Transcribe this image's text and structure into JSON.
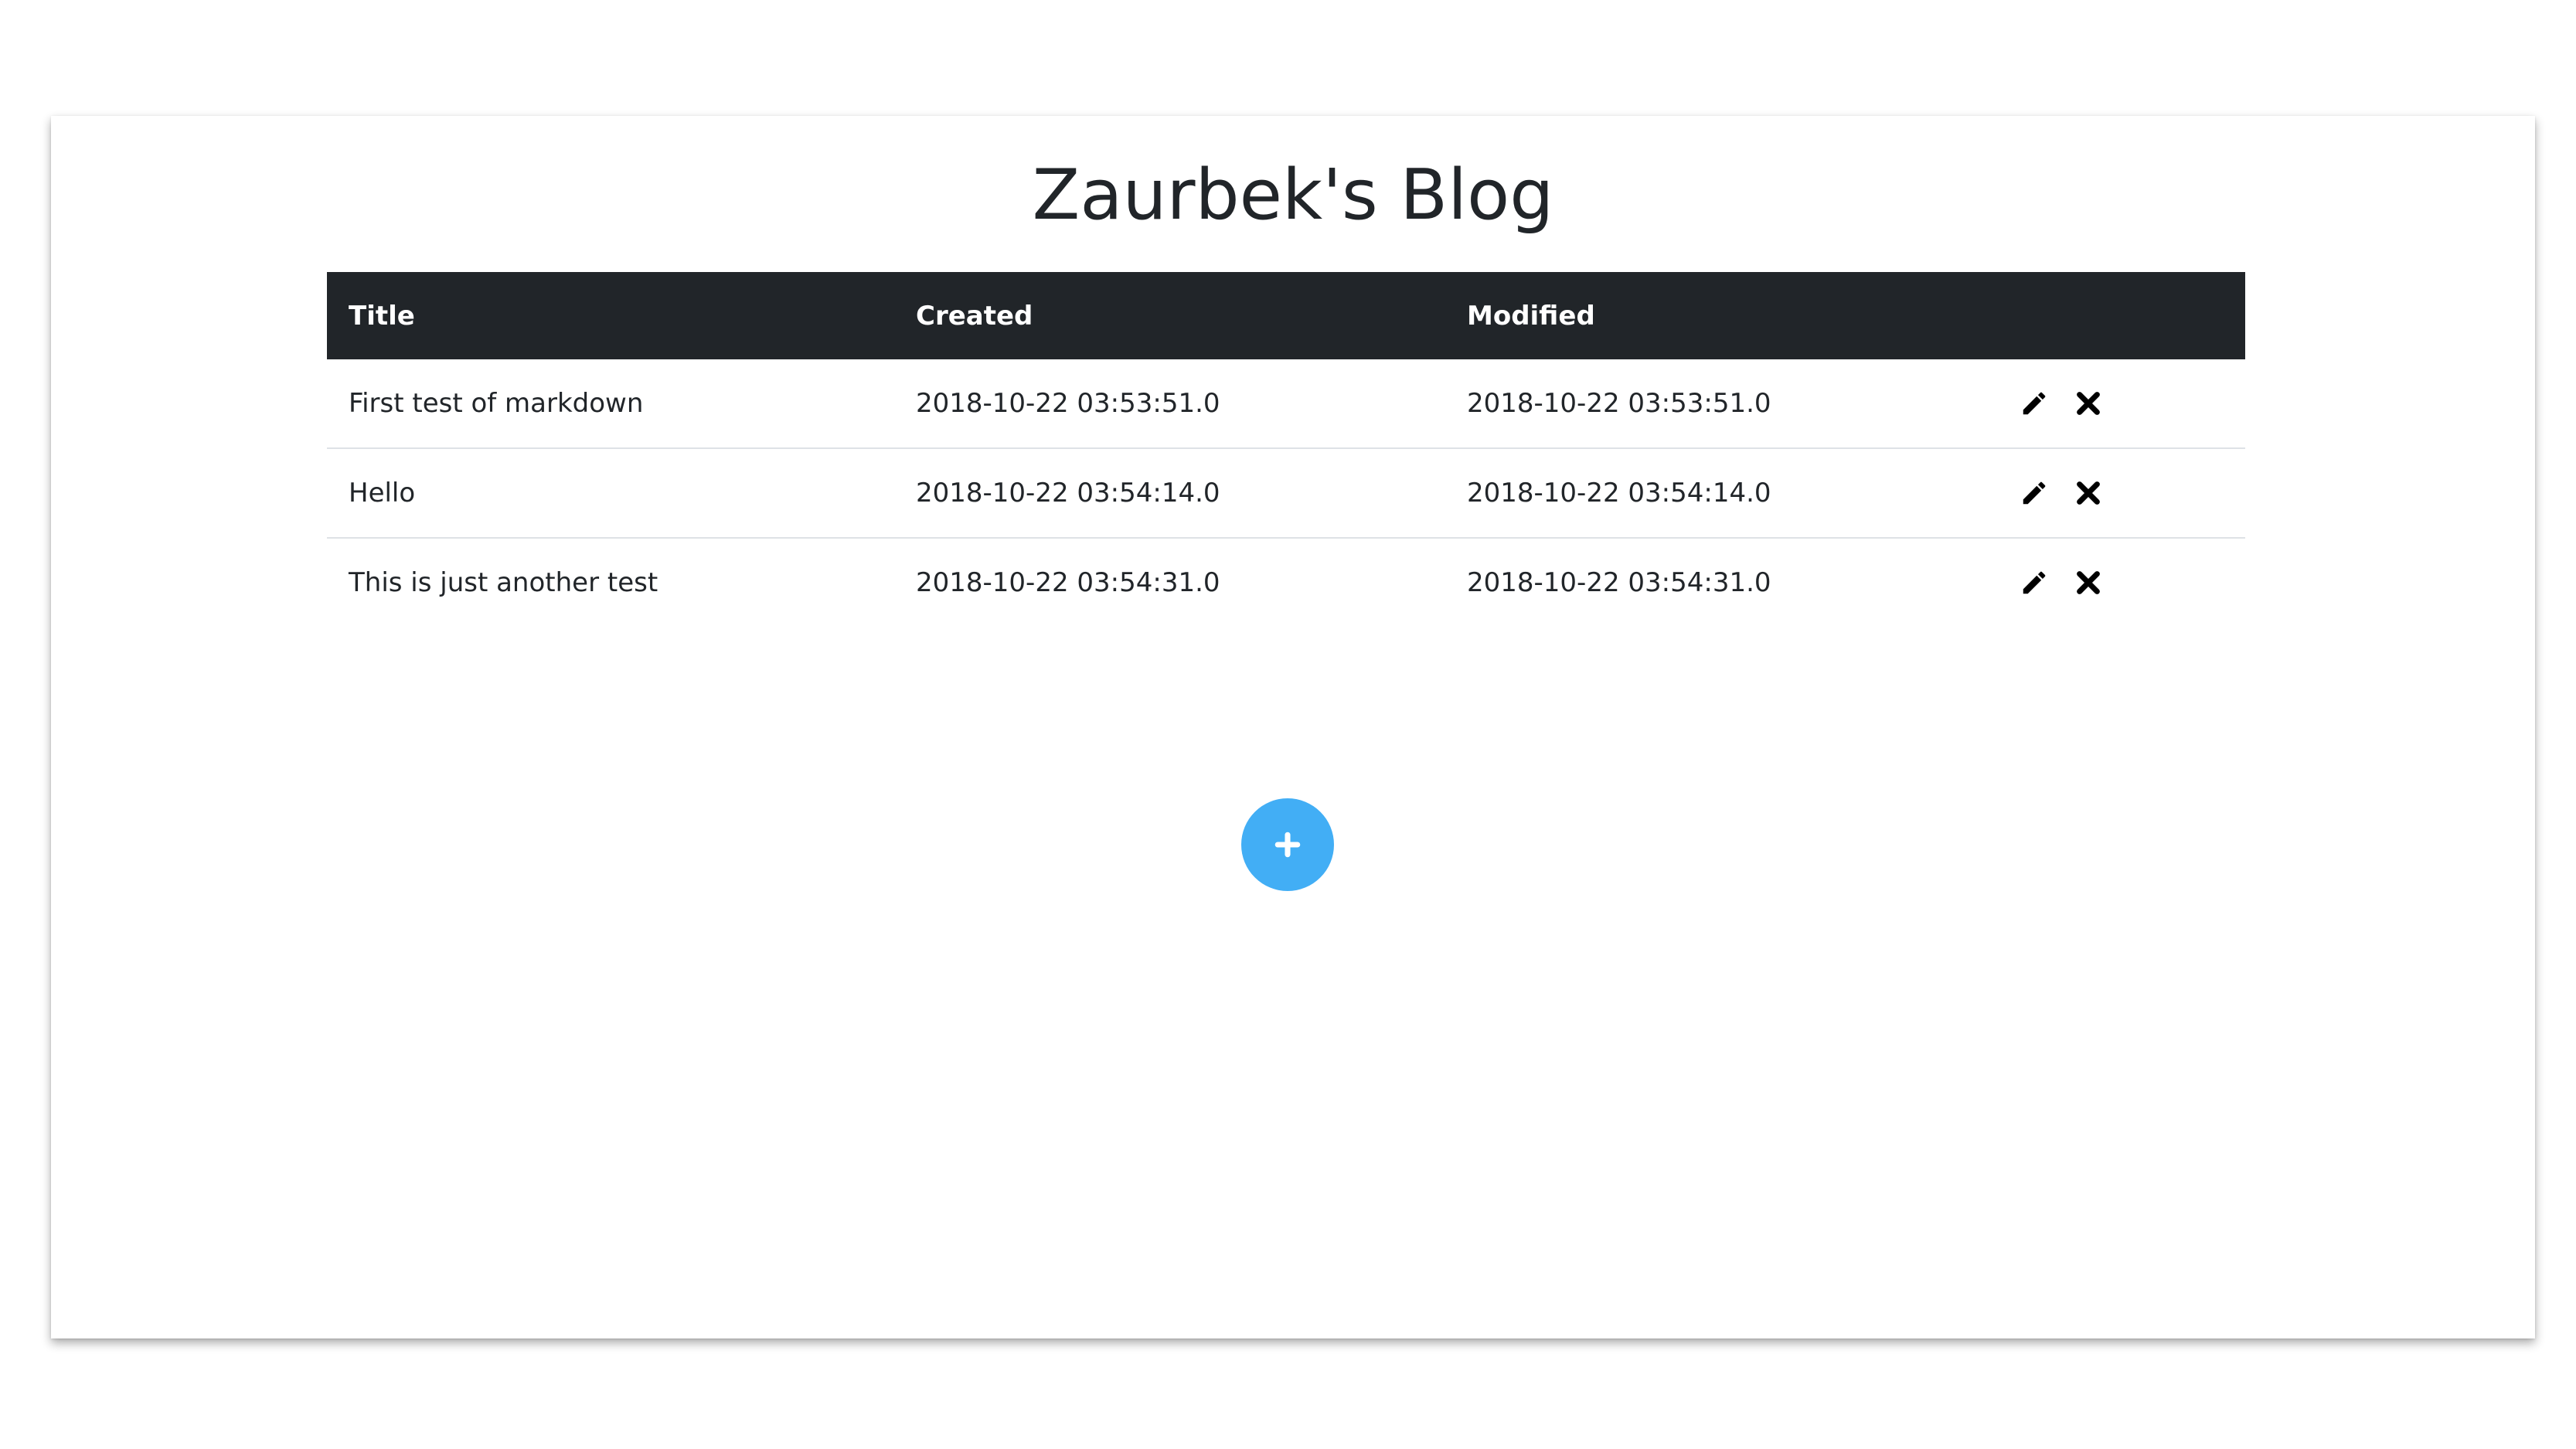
{
  "page": {
    "title": "Zaurbek's Blog"
  },
  "table": {
    "headers": {
      "title": "Title",
      "created": "Created",
      "modified": "Modified",
      "actions": ""
    },
    "rows": [
      {
        "title": "First test of markdown",
        "created": "2018-10-22 03:53:51.0",
        "modified": "2018-10-22 03:53:51.0",
        "edit_icon": "pencil-icon",
        "delete_icon": "close-icon"
      },
      {
        "title": "Hello",
        "created": "2018-10-22 03:54:14.0",
        "modified": "2018-10-22 03:54:14.0",
        "edit_icon": "pencil-icon",
        "delete_icon": "close-icon"
      },
      {
        "title": "This is just another test",
        "created": "2018-10-22 03:54:31.0",
        "modified": "2018-10-22 03:54:31.0",
        "edit_icon": "pencil-icon",
        "delete_icon": "close-icon"
      }
    ]
  },
  "add_button": {
    "icon": "plus-icon"
  },
  "colors": {
    "header_background": "#212529",
    "header_text": "#ffffff",
    "add_button": "#42aef5",
    "row_divider": "#dee2e6"
  }
}
